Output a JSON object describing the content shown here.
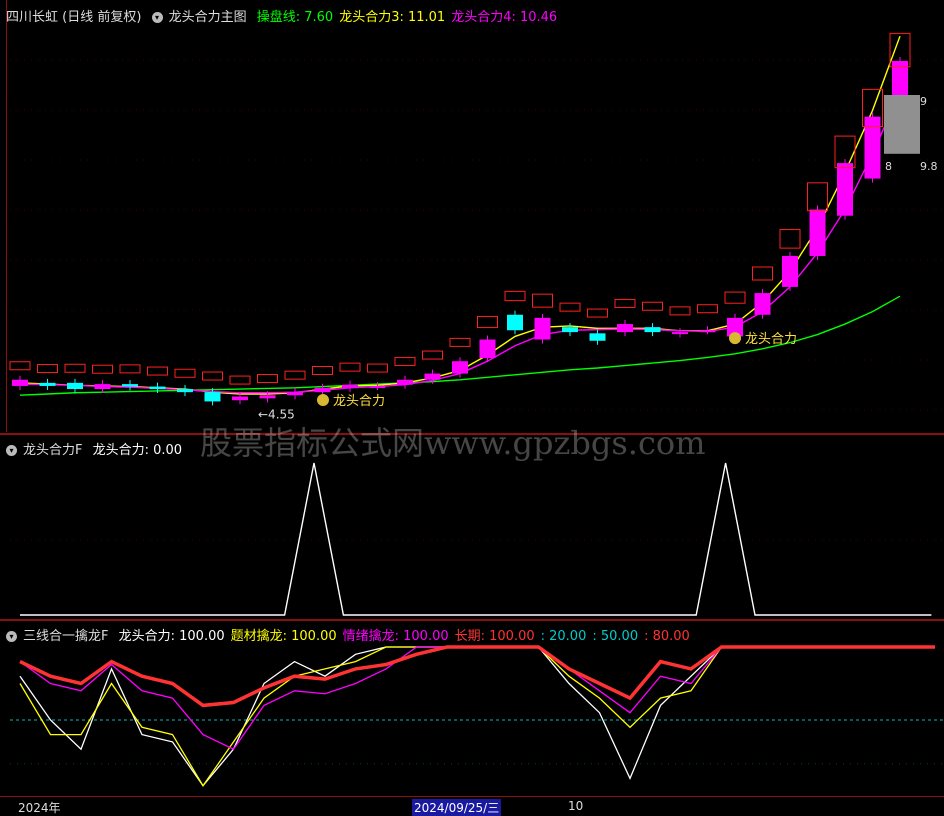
{
  "colors": {
    "up": "#ff00ff",
    "down": "#00ffff",
    "green": "#00ff00",
    "red": "#ff0000",
    "yellow": "#ffff00",
    "magenta": "#ff00ff",
    "white": "#ffffff",
    "gray": "#909090"
  },
  "panel1": {
    "title": "四川长虹 (日线 前复权)",
    "formula": "龙头合力主图",
    "items": [
      {
        "label": "操盘线: 7.60",
        "color": "#00ff00"
      },
      {
        "label": "龙头合力3: 11.01",
        "color": "#ffff00"
      },
      {
        "label": "龙头合力4: 10.46",
        "color": "#ff00ff"
      }
    ],
    "price_low_label": "←4.55",
    "marker_label": "龙头合力",
    "price_labels": [
      "8",
      "9.8",
      "9"
    ],
    "icon": "money-bag-icon"
  },
  "panel2": {
    "title": "龙头合力F",
    "items": [
      {
        "label": "龙头合力: 0.00",
        "color": "#ffffff"
      }
    ]
  },
  "panel3": {
    "title": "三线合一擒龙F",
    "items": [
      {
        "label": "龙头合力: 100.00",
        "color": "#ffffff"
      },
      {
        "label": "题材擒龙: 100.00",
        "color": "#ffff00"
      },
      {
        "label": "情绪擒龙: 100.00",
        "color": "#ff00ff"
      },
      {
        "label": "长期: 100.00",
        "color": "#ff3333"
      },
      {
        "label": ": 20.00",
        "color": "#00cccc"
      },
      {
        "label": ": 50.00",
        "color": "#00cccc"
      },
      {
        "label": ": 80.00",
        "color": "#ff3333"
      }
    ]
  },
  "axis": {
    "year": "2024年",
    "date": "2024/09/25/三",
    "day": "10"
  },
  "watermark": "股票指标公式网www.gpzbgs.com",
  "chart_data": [
    {
      "type": "candlestick",
      "candles": [
        {
          "o": 4.85,
          "c": 4.95
        },
        {
          "o": 4.9,
          "c": 4.85
        },
        {
          "o": 4.9,
          "c": 4.8
        },
        {
          "o": 4.8,
          "c": 4.88
        },
        {
          "o": 4.88,
          "c": 4.84
        },
        {
          "o": 4.84,
          "c": 4.8
        },
        {
          "o": 4.8,
          "c": 4.75
        },
        {
          "o": 4.75,
          "c": 4.6
        },
        {
          "o": 4.62,
          "c": 4.68
        },
        {
          "o": 4.65,
          "c": 4.7
        },
        {
          "o": 4.7,
          "c": 4.75
        },
        {
          "o": 4.75,
          "c": 4.82
        },
        {
          "o": 4.82,
          "c": 4.87
        },
        {
          "o": 4.85,
          "c": 4.85
        },
        {
          "o": 4.87,
          "c": 4.95
        },
        {
          "o": 4.95,
          "c": 5.05
        },
        {
          "o": 5.05,
          "c": 5.25
        },
        {
          "o": 5.3,
          "c": 5.6
        },
        {
          "o": 6.0,
          "c": 5.75
        },
        {
          "o": 5.6,
          "c": 5.95
        },
        {
          "o": 5.8,
          "c": 5.72
        },
        {
          "o": 5.7,
          "c": 5.58
        },
        {
          "o": 5.72,
          "c": 5.85
        },
        {
          "o": 5.8,
          "c": 5.72
        },
        {
          "o": 5.7,
          "c": 5.72
        },
        {
          "o": 5.75,
          "c": 5.75
        },
        {
          "o": 5.65,
          "c": 5.95
        },
        {
          "o": 6.0,
          "c": 6.35
        },
        {
          "o": 6.45,
          "c": 6.95
        },
        {
          "o": 6.95,
          "c": 7.7
        },
        {
          "o": 7.6,
          "c": 8.45
        },
        {
          "o": 8.2,
          "c": 9.2
        },
        {
          "o": 9.2,
          "c": 10.1
        }
      ],
      "lines": [
        {
          "name": "操盘线",
          "color": "#00ff00",
          "values": [
            4.7,
            4.72,
            4.74,
            4.75,
            4.76,
            4.77,
            4.78,
            4.79,
            4.8,
            4.81,
            4.82,
            4.84,
            4.86,
            4.88,
            4.9,
            4.92,
            4.95,
            4.99,
            5.03,
            5.07,
            5.11,
            5.14,
            5.18,
            5.22,
            5.26,
            5.31,
            5.37,
            5.45,
            5.55,
            5.68,
            5.85,
            6.05,
            6.3
          ]
        },
        {
          "name": "龙头合力3",
          "color": "#ffff00",
          "values": [
            4.9,
            4.88,
            4.86,
            4.85,
            4.84,
            4.82,
            4.8,
            4.75,
            4.72,
            4.72,
            4.74,
            4.8,
            4.85,
            4.86,
            4.9,
            4.98,
            5.1,
            5.35,
            5.65,
            5.8,
            5.82,
            5.78,
            5.78,
            5.78,
            5.74,
            5.74,
            5.85,
            6.2,
            6.7,
            7.4,
            8.3,
            9.3,
            10.5
          ]
        },
        {
          "name": "龙头合力4",
          "color": "#ff00ff",
          "values": [
            4.88,
            4.87,
            4.86,
            4.84,
            4.83,
            4.81,
            4.79,
            4.76,
            4.74,
            4.74,
            4.75,
            4.78,
            4.82,
            4.84,
            4.87,
            4.94,
            5.05,
            5.25,
            5.5,
            5.68,
            5.75,
            5.76,
            5.77,
            5.76,
            5.74,
            5.73,
            5.8,
            6.05,
            6.45,
            7.0,
            7.7,
            8.6,
            9.6
          ]
        }
      ]
    },
    {
      "type": "line",
      "series": [
        {
          "name": "龙头合力",
          "color": "#ffffff",
          "values": [
            0,
            0,
            0,
            0,
            0,
            0,
            0,
            0,
            0,
            0,
            100,
            0,
            0,
            0,
            0,
            0,
            0,
            0,
            0,
            0,
            0,
            0,
            0,
            0,
            100,
            0,
            0,
            0,
            0,
            0,
            0,
            0
          ]
        }
      ],
      "ylim": [
        0,
        100
      ]
    },
    {
      "type": "line",
      "series": [
        {
          "name": "龙头合力",
          "color": "#ffffff",
          "values": [
            80,
            50,
            30,
            85,
            40,
            35,
            5,
            30,
            75,
            90,
            80,
            95,
            100,
            100,
            100,
            100,
            100,
            100,
            75,
            55,
            10,
            60,
            80,
            100,
            100,
            100,
            100,
            100,
            100,
            100,
            100
          ]
        },
        {
          "name": "题材擒龙",
          "color": "#ffff00",
          "values": [
            75,
            40,
            40,
            75,
            45,
            40,
            5,
            35,
            65,
            80,
            85,
            90,
            100,
            100,
            100,
            100,
            100,
            100,
            80,
            65,
            45,
            65,
            70,
            100,
            100,
            100,
            100,
            100,
            100,
            100,
            100
          ]
        },
        {
          "name": "情绪擒龙",
          "color": "#ff00ff",
          "values": [
            90,
            75,
            70,
            88,
            70,
            65,
            40,
            30,
            60,
            70,
            68,
            75,
            85,
            100,
            100,
            100,
            100,
            100,
            85,
            70,
            55,
            80,
            75,
            100,
            100,
            100,
            100,
            100,
            100,
            100,
            100
          ]
        },
        {
          "name": "长期",
          "color": "#ff3333",
          "values": [
            90,
            80,
            75,
            90,
            80,
            75,
            60,
            62,
            72,
            80,
            78,
            85,
            88,
            95,
            100,
            100,
            100,
            100,
            85,
            75,
            65,
            90,
            85,
            100,
            100,
            100,
            100,
            100,
            100,
            100,
            100
          ]
        }
      ],
      "ylim": [
        0,
        100
      ]
    }
  ]
}
